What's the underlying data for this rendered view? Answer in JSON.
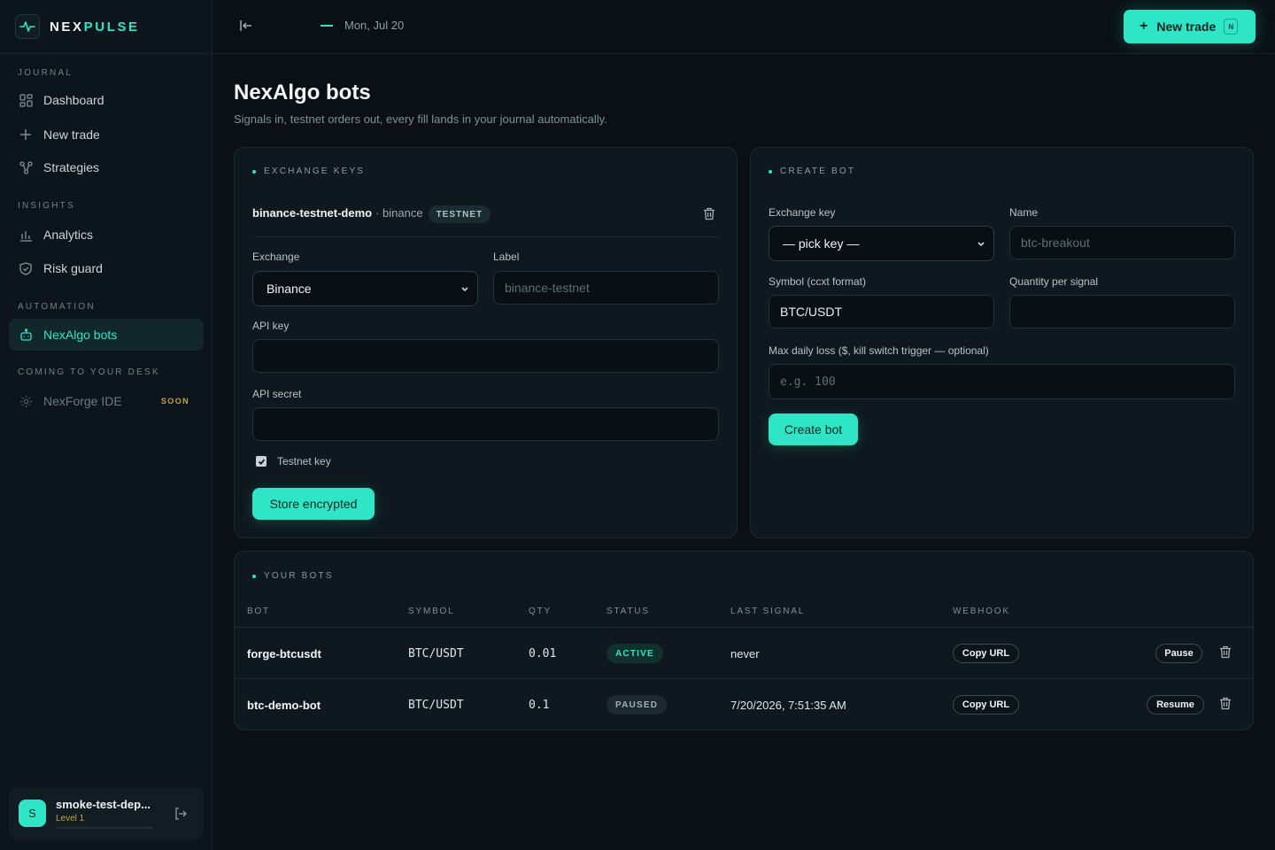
{
  "brand": {
    "name_a": "NEX",
    "name_b": "PULSE"
  },
  "sidebar": {
    "sections": [
      {
        "label": "JOURNAL"
      },
      {
        "label": "INSIGHTS"
      },
      {
        "label": "AUTOMATION"
      },
      {
        "label": "COMING TO YOUR DESK"
      }
    ],
    "items": [
      {
        "label": "Dashboard",
        "icon": "grid-icon"
      },
      {
        "label": "New trade",
        "icon": "plus-icon"
      },
      {
        "label": "Strategies",
        "icon": "nodes-icon"
      },
      {
        "label": "Analytics",
        "icon": "bar-chart-icon"
      },
      {
        "label": "Risk guard",
        "icon": "shield-icon"
      },
      {
        "label": "NexAlgo bots",
        "icon": "bot-icon",
        "active": true
      },
      {
        "label": "NexForge IDE",
        "icon": "gear-icon",
        "badge": "SOON",
        "disabled": true
      }
    ],
    "user": {
      "initial": "S",
      "name": "smoke-test-dep...",
      "level": "Level 1"
    }
  },
  "topbar": {
    "date": "Mon, Jul 20",
    "new_trade_label": "New trade",
    "shortcut": "N"
  },
  "page": {
    "title": "NexAlgo bots",
    "subtitle": "Signals in, testnet orders out, every fill lands in your journal automatically."
  },
  "exchange_keys": {
    "heading": "EXCHANGE KEYS",
    "stored_key": {
      "name": "binance-testnet-demo",
      "exchange": "· binance",
      "badge": "TESTNET"
    },
    "exchange_label": "Exchange",
    "exchange_value": "Binance",
    "label_label": "Label",
    "label_placeholder": "binance-testnet",
    "api_key_label": "API key",
    "api_secret_label": "API secret",
    "testnet_label": "Testnet key",
    "testnet_checked": true,
    "submit_label": "Store encrypted"
  },
  "create_bot": {
    "heading": "CREATE BOT",
    "exchange_key_label": "Exchange key",
    "exchange_key_value": "— pick key —",
    "name_label": "Name",
    "name_placeholder": "btc-breakout",
    "symbol_label": "Symbol (ccxt format)",
    "symbol_value": "BTC/USDT",
    "qty_label": "Quantity per signal",
    "max_loss_label": "Max daily loss ($, kill switch trigger — optional)",
    "max_loss_placeholder": "e.g. 100",
    "submit_label": "Create bot"
  },
  "bots": {
    "heading": "YOUR BOTS",
    "columns": [
      "BOT",
      "SYMBOL",
      "QTY",
      "STATUS",
      "LAST SIGNAL",
      "WEBHOOK"
    ],
    "rows": [
      {
        "bot": "forge-btcusdt",
        "symbol": "BTC/USDT",
        "qty": "0.01",
        "status": "ACTIVE",
        "last_signal": "never",
        "webhook": "Copy URL",
        "action": "Pause"
      },
      {
        "bot": "btc-demo-bot",
        "symbol": "BTC/USDT",
        "qty": "0.1",
        "status": "PAUSED",
        "last_signal": "7/20/2026, 7:51:35 AM",
        "webhook": "Copy URL",
        "action": "Resume"
      }
    ]
  },
  "colors": {
    "accent": "#2ee6c6",
    "background": "#0a1015",
    "card": "#0e181e",
    "gold": "#c9a23a"
  }
}
